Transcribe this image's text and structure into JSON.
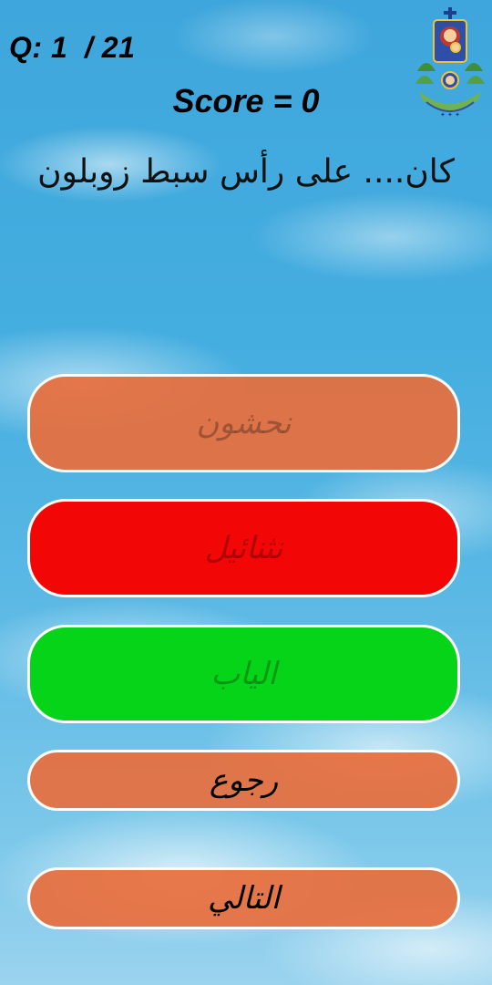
{
  "header": {
    "question_counter": "Q: 1  / 21",
    "score": "Score = 0"
  },
  "question": {
    "text": "كان.... على رأس سبط زوبلون"
  },
  "answers": [
    {
      "label": "نحشون",
      "state": "neutral",
      "color": "#e86e3c"
    },
    {
      "label": "نثنائيل",
      "state": "wrong",
      "color": "#f20606"
    },
    {
      "label": "الياب",
      "state": "correct",
      "color": "#06d418"
    }
  ],
  "navigation": {
    "back_label": "رجوع",
    "next_label": "التالي"
  },
  "logo": {
    "icon": "church-emblem-icon"
  }
}
